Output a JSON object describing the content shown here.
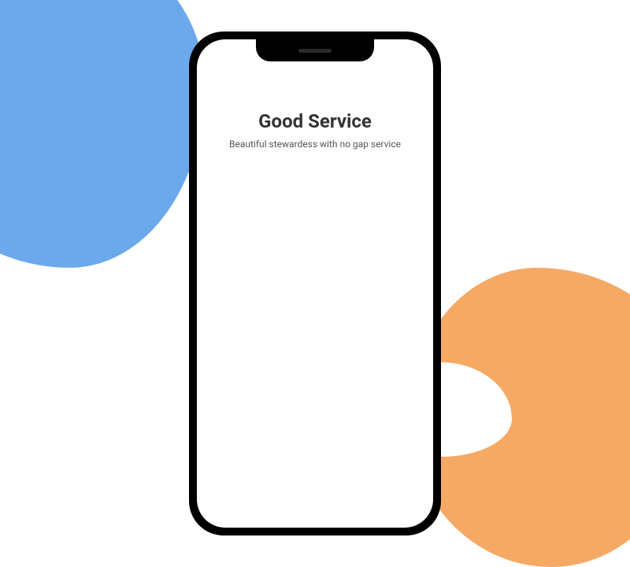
{
  "content": {
    "headline": "Good Service",
    "subtext": "Beautiful stewardess with no gap service"
  }
}
